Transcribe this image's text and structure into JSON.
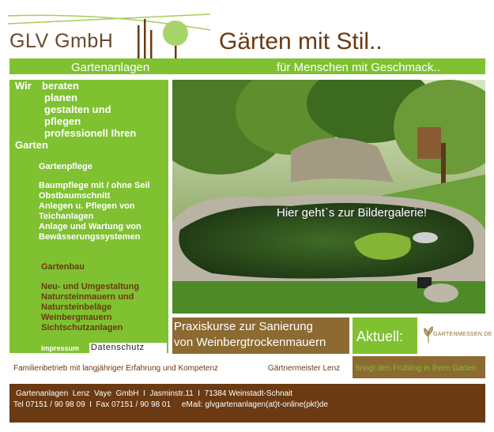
{
  "header": {
    "logo_text": "GLV GmbH",
    "headline": "Gärten mit Stil..",
    "subtitle_left": "Gartenanlagen",
    "subtitle_right": "für Menschen mit Geschmack.."
  },
  "sidebar": {
    "intro_lines": [
      "Wir",
      "beraten",
      "planen",
      "gestalten und",
      "pflegen",
      "professionell Ihren",
      "Garten"
    ],
    "section1_title": "Gartenpflege",
    "section1_items": [
      "Baumpflege mit / ohne Seil",
      "Obstbaumschnitt",
      "Anlegen u. Pflegen von",
      "Teichanlagen",
      "Anlage und Wartung von",
      "Bewässerungssystemen"
    ],
    "section2_title": "Gartenbau",
    "section2_items": [
      "Neu- und Umgestaltung",
      "Natursteinmauern und",
      "Natursteinbeläge",
      "Weinbergmauern",
      "Sichtschutzanlagen"
    ],
    "impressum": "Impressum",
    "datenschutz": "Datenschutz"
  },
  "main": {
    "gallery_link": "Hier geht`s zur Bildergalerie!",
    "kurse_line1": "Praxiskurse zur Sanierung",
    "kurse_line2": "von Weinbergtrockenmauern",
    "aktuell": "Aktuell:",
    "messen_logo": "GARTENMESSEN.DE"
  },
  "footer": {
    "family": "Familienbetrieb mit langjähriger Erfahrung und Kompetenz",
    "meister": "Gärtnermeister Lenz",
    "fruehling": "bringt den Frühling in Ihren Garten",
    "address_line1": "Gartenanlagen  Lenz  Vaye  GmbH  I  Jasminstr.11  I  71384 Weinstadt-Schnait",
    "address_line2": "Tel 07151 / 90 98 09  I  Fax 07151 / 90 98 01     eMail: glvgartenanlagen(at)t-online(pkt)de"
  },
  "colors": {
    "green": "#7fc131",
    "brown": "#6b3a12",
    "light_brown": "#8c6a32"
  }
}
